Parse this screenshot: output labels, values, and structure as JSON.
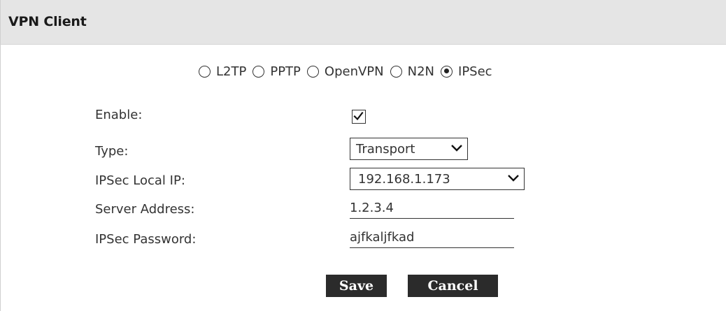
{
  "panel": {
    "title": "VPN Client"
  },
  "protocols": {
    "options": [
      {
        "label": "L2TP",
        "selected": false
      },
      {
        "label": "PPTP",
        "selected": false
      },
      {
        "label": "OpenVPN",
        "selected": false
      },
      {
        "label": "N2N",
        "selected": false
      },
      {
        "label": "IPSec",
        "selected": true
      }
    ]
  },
  "form": {
    "enable": {
      "label": "Enable:",
      "checked": true
    },
    "type": {
      "label": "Type:",
      "value": "Transport"
    },
    "local_ip": {
      "label": "IPSec Local IP:",
      "value": "192.168.1.173"
    },
    "server_address": {
      "label": "Server Address:",
      "value": "1.2.3.4"
    },
    "password": {
      "label": "IPSec Password:",
      "value": "ajfkaljfkad"
    }
  },
  "actions": {
    "save_label": "Save",
    "cancel_label": "Cancel"
  },
  "colors": {
    "header_bg": "#e5e5e5",
    "button_bg": "#2b2b2b",
    "text": "#333333"
  }
}
